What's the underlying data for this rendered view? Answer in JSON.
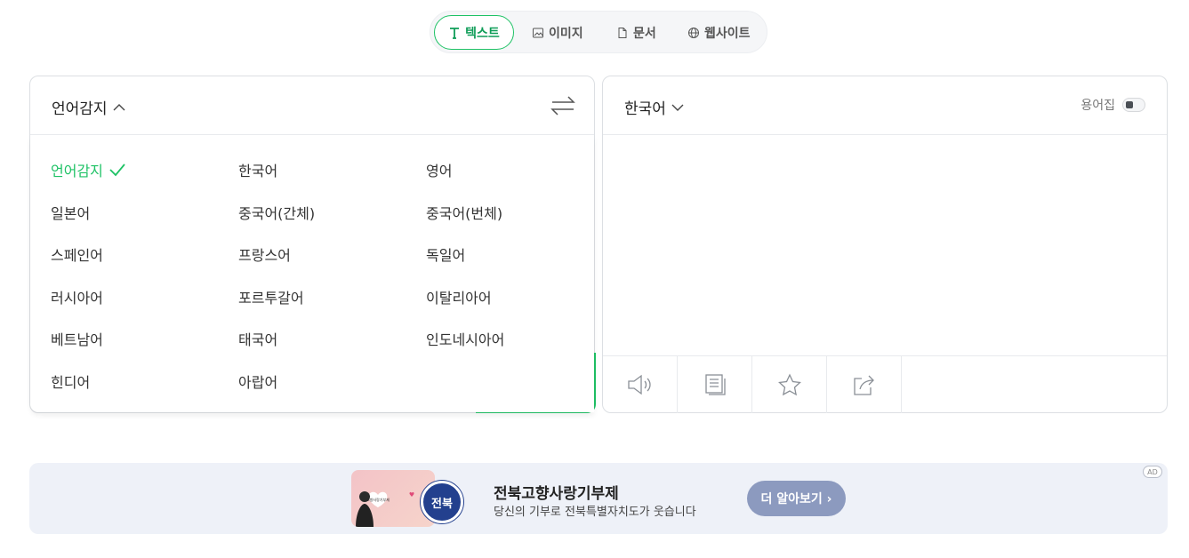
{
  "mode_tabs": {
    "text": "텍스트",
    "image": "이미지",
    "document": "문서",
    "website": "웹사이트"
  },
  "source": {
    "language": "언어감지",
    "options": [
      "언어감지",
      "한국어",
      "영어",
      "일본어",
      "중국어(간체)",
      "중국어(번체)",
      "스페인어",
      "프랑스어",
      "독일어",
      "러시아어",
      "포르투갈어",
      "이탈리아어",
      "베트남어",
      "태국어",
      "인도네시아어",
      "힌디어",
      "아랍어"
    ],
    "selected_index": 0
  },
  "target": {
    "language": "한국어",
    "glossary_label": "용어집"
  },
  "ad": {
    "title": "전북고향사랑기부제",
    "subtitle": "당신의 기부로 전북특별자치도가 웃습니다",
    "cta": "더 알아보기 ›",
    "badge": "AD",
    "seal_text": "전북",
    "image_heart_text": "고향사랑기부제"
  },
  "colors": {
    "accent": "#1ec265",
    "cta": "#8c9abf",
    "ad_bg": "#eef1f8"
  }
}
